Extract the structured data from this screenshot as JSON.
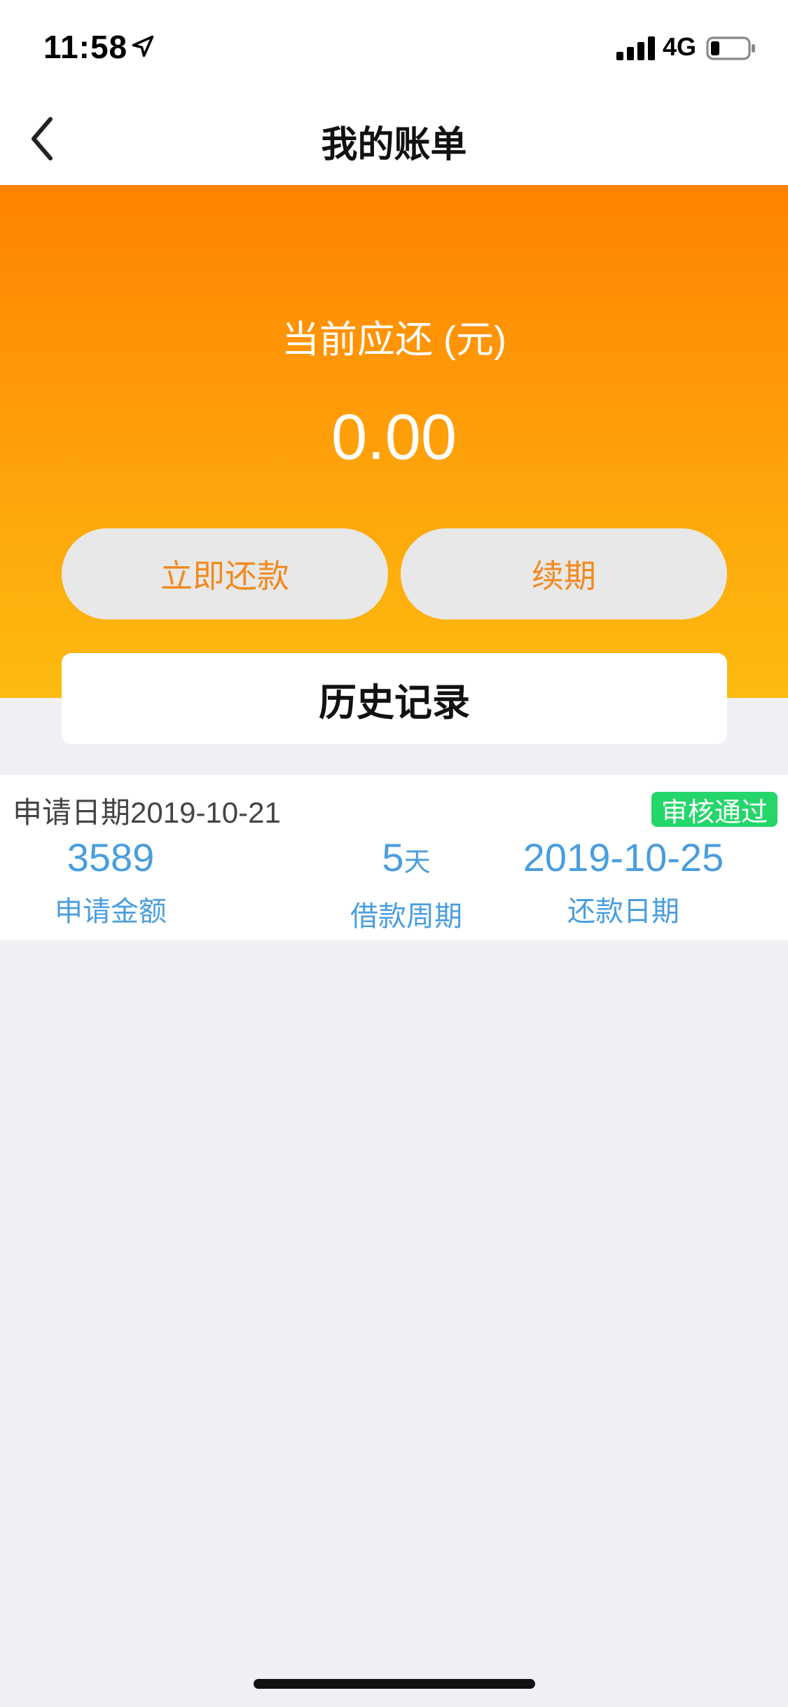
{
  "status_bar": {
    "time": "11:58",
    "network": "4G"
  },
  "nav": {
    "title": "我的账单"
  },
  "hero": {
    "label": "当前应还 (元)",
    "amount": "0.00"
  },
  "actions": {
    "repay_label": "立即还款",
    "renew_label": "续期"
  },
  "history": {
    "title": "历史记录"
  },
  "record": {
    "apply_date_label": "申请日期",
    "apply_date": "2019-10-21",
    "status": "审核通过",
    "amount": "3589",
    "amount_label": "申请金额",
    "period_value": "5",
    "period_unit": "天",
    "period_label": "借款周期",
    "repay_date": "2019-10-25",
    "repay_date_label": "还款日期"
  },
  "colors": {
    "accent_orange": "#ff8200",
    "accent_yellow": "#fdbb10",
    "button_text": "#f18a1f",
    "value_blue": "#4a9edd",
    "badge_green": "#25d66a"
  },
  "icons": [
    "location-arrow-icon",
    "signal-icon",
    "battery-icon",
    "back-chevron-icon"
  ]
}
